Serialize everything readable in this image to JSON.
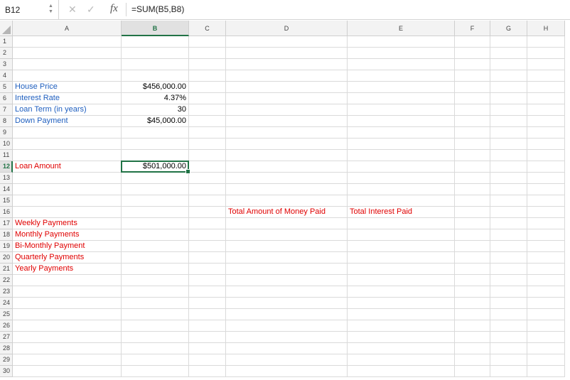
{
  "formula_bar": {
    "name_box": "B12",
    "formula": "=SUM(B5,B8)",
    "fx": "fx",
    "cancel": "✕",
    "enter": "✓"
  },
  "columns": [
    "A",
    "B",
    "C",
    "D",
    "E",
    "F",
    "G",
    "H"
  ],
  "selected": {
    "col": "B",
    "row": 12
  },
  "row_count": 30,
  "colors": {
    "blue": "#1f5fbf",
    "red": "#e00000",
    "accent": "#217346"
  },
  "cells": [
    {
      "ref": "A5",
      "text": "House Price",
      "color": "blue"
    },
    {
      "ref": "B5",
      "text": "$456,000.00",
      "align": "right"
    },
    {
      "ref": "A6",
      "text": "Interest Rate",
      "color": "blue"
    },
    {
      "ref": "B6",
      "text": "4.37%",
      "align": "right"
    },
    {
      "ref": "A7",
      "text": "Loan Term (in years)",
      "color": "blue"
    },
    {
      "ref": "B7",
      "text": "30",
      "align": "right"
    },
    {
      "ref": "A8",
      "text": "Down Payment",
      "color": "blue"
    },
    {
      "ref": "B8",
      "text": "$45,000.00",
      "align": "right"
    },
    {
      "ref": "A12",
      "text": "Loan Amount",
      "color": "red"
    },
    {
      "ref": "B12",
      "text": "$501,000.00",
      "align": "right"
    },
    {
      "ref": "D16",
      "text": "Total Amount of Money Paid",
      "color": "red"
    },
    {
      "ref": "E16",
      "text": "Total Interest Paid",
      "color": "red"
    },
    {
      "ref": "A17",
      "text": "Weekly Payments",
      "color": "red"
    },
    {
      "ref": "A18",
      "text": "Monthly Payments",
      "color": "red"
    },
    {
      "ref": "A19",
      "text": "Bi-Monthly Payment",
      "color": "red"
    },
    {
      "ref": "A20",
      "text": "Quarterly Payments",
      "color": "red"
    },
    {
      "ref": "A21",
      "text": "Yearly Payments",
      "color": "red"
    }
  ]
}
